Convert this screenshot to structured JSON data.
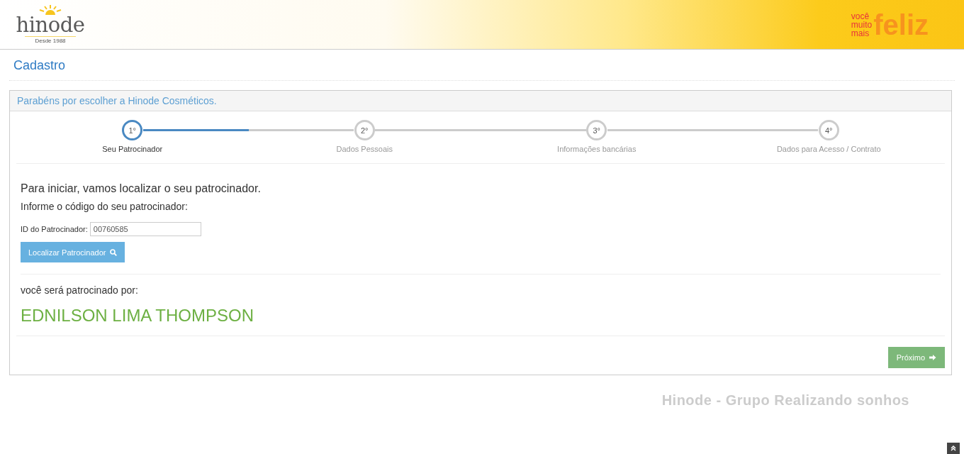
{
  "header": {
    "logo": {
      "name": "hinode",
      "tagline": "Desde 1988"
    },
    "slogan": {
      "lines": [
        "você",
        "muito",
        "mais"
      ],
      "big": "feliz"
    }
  },
  "page_title": "Cadastro",
  "panel": {
    "heading": "Parabéns por escolher a Hinode Cosméticos.",
    "progress": {
      "level": 0.5
    },
    "steps": [
      {
        "number": "1°",
        "label": "Seu Patrocinador",
        "selected": true
      },
      {
        "number": "2°",
        "label": "Dados Pessoais",
        "selected": false
      },
      {
        "number": "3°",
        "label": "Informações bancárias",
        "selected": false
      },
      {
        "number": "4°",
        "label": "Dados para Acesso / Contrato",
        "selected": false
      }
    ],
    "intro": "Para iniciar, vamos localizar o seu patrocinador.",
    "instruction": "Informe o código do seu patrocinador:",
    "sponsor_field": {
      "label": "ID do Patrocinador:",
      "value": "00760585"
    },
    "search_button": "Localizar Patrocinador",
    "result_label": "você será patrocinado por:",
    "sponsor_name": "EDNILSON LIMA THOMPSON",
    "next_button": "Próximo"
  },
  "footer": "Hinode - Grupo Realizando sonhos"
}
